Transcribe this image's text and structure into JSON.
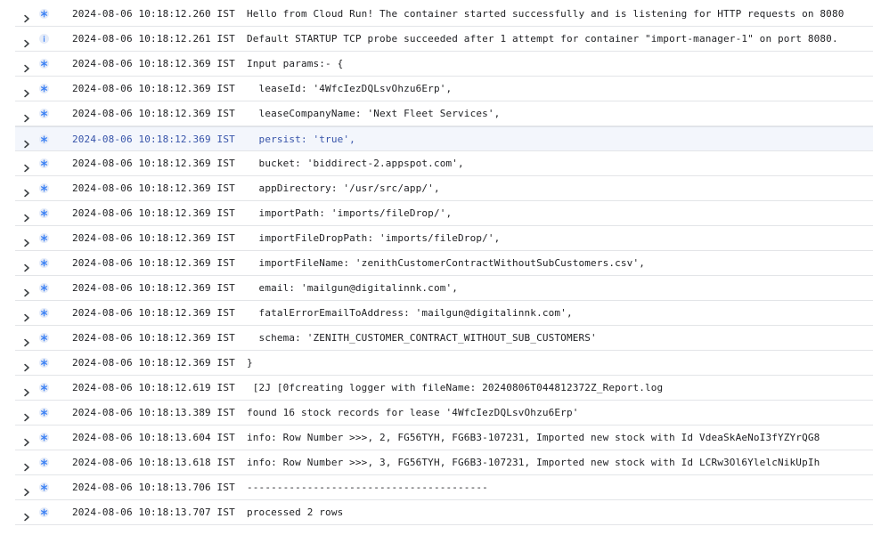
{
  "icons": {
    "expand": "chevron-right-icon",
    "debug": "asterisk-icon",
    "info": "info-icon"
  },
  "colors": {
    "severity_icon": "#4285f4",
    "severity_bg": "#e6ecf8",
    "highlight_bg": "#f3f6fc",
    "highlight_text": "#3653a9"
  },
  "log_entries": [
    {
      "severity": "debug",
      "timestamp": "2024-08-06 10:18:12.260 IST",
      "message": "Hello from Cloud Run! The container started successfully and is listening for HTTP requests on 8080"
    },
    {
      "severity": "info",
      "timestamp": "2024-08-06 10:18:12.261 IST",
      "message": "Default STARTUP TCP probe succeeded after 1 attempt for container \"import-manager-1\" on port 8080."
    },
    {
      "severity": "debug",
      "timestamp": "2024-08-06 10:18:12.369 IST",
      "message": "Input params:- {"
    },
    {
      "severity": "debug",
      "timestamp": "2024-08-06 10:18:12.369 IST",
      "message": "  leaseId: '4WfcIezDQLsvOhzu6Erp',"
    },
    {
      "severity": "debug",
      "timestamp": "2024-08-06 10:18:12.369 IST",
      "message": "  leaseCompanyName: 'Next Fleet Services',"
    },
    {
      "severity": "debug",
      "timestamp": "2024-08-06 10:18:12.369 IST",
      "message": "  persist: 'true',",
      "highlight": true
    },
    {
      "severity": "debug",
      "timestamp": "2024-08-06 10:18:12.369 IST",
      "message": "  bucket: 'biddirect-2.appspot.com',"
    },
    {
      "severity": "debug",
      "timestamp": "2024-08-06 10:18:12.369 IST",
      "message": "  appDirectory: '/usr/src/app/',"
    },
    {
      "severity": "debug",
      "timestamp": "2024-08-06 10:18:12.369 IST",
      "message": "  importPath: 'imports/fileDrop/',"
    },
    {
      "severity": "debug",
      "timestamp": "2024-08-06 10:18:12.369 IST",
      "message": "  importFileDropPath: 'imports/fileDrop/',"
    },
    {
      "severity": "debug",
      "timestamp": "2024-08-06 10:18:12.369 IST",
      "message": "  importFileName: 'zenithCustomerContractWithoutSubCustomers.csv',"
    },
    {
      "severity": "debug",
      "timestamp": "2024-08-06 10:18:12.369 IST",
      "message": "  email: 'mailgun@digitalinnk.com',"
    },
    {
      "severity": "debug",
      "timestamp": "2024-08-06 10:18:12.369 IST",
      "message": "  fatalErrorEmailToAddress: 'mailgun@digitalinnk.com',"
    },
    {
      "severity": "debug",
      "timestamp": "2024-08-06 10:18:12.369 IST",
      "message": "  schema: 'ZENITH_CUSTOMER_CONTRACT_WITHOUT_SUB_CUSTOMERS'"
    },
    {
      "severity": "debug",
      "timestamp": "2024-08-06 10:18:12.369 IST",
      "message": "}"
    },
    {
      "severity": "debug",
      "timestamp": "2024-08-06 10:18:12.619 IST",
      "message": " [2J [0fcreating logger with fileName: 20240806T044812372Z_Report.log"
    },
    {
      "severity": "debug",
      "timestamp": "2024-08-06 10:18:13.389 IST",
      "message": "found 16 stock records for lease '4WfcIezDQLsvOhzu6Erp'"
    },
    {
      "severity": "debug",
      "timestamp": "2024-08-06 10:18:13.604 IST",
      "message": "info: Row Number >>>, 2, FG56TYH, FG6B3-107231, Imported new stock with Id VdeaSkAeNoI3fYZYrQG8"
    },
    {
      "severity": "debug",
      "timestamp": "2024-08-06 10:18:13.618 IST",
      "message": "info: Row Number >>>, 3, FG56TYH, FG6B3-107231, Imported new stock with Id LCRw3Ol6YlelcNikUpIh"
    },
    {
      "severity": "debug",
      "timestamp": "2024-08-06 10:18:13.706 IST",
      "message": "----------------------------------------"
    },
    {
      "severity": "debug",
      "timestamp": "2024-08-06 10:18:13.707 IST",
      "message": "processed 2 rows"
    }
  ]
}
